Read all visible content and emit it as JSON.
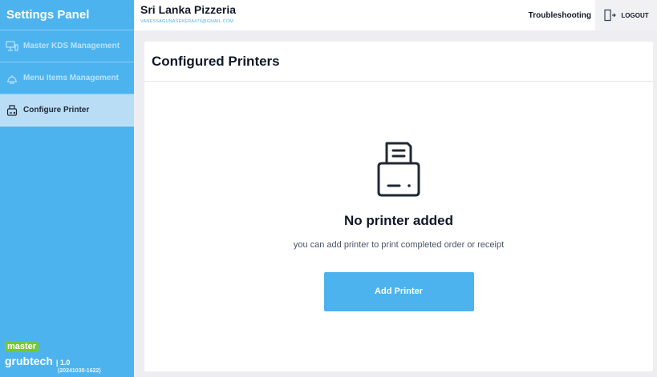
{
  "sidebar": {
    "title": "Settings Panel",
    "items": [
      {
        "label": "Master KDS Management",
        "icon": "kds-icon",
        "active": false
      },
      {
        "label": "Menu Items Management",
        "icon": "menu-items-icon",
        "active": false
      },
      {
        "label": "Configure Printer",
        "icon": "printer-icon",
        "active": true
      }
    ],
    "brand": {
      "badge": "master",
      "name": "grubtech",
      "version": "| 1.0",
      "build": "(20241030-1622)"
    }
  },
  "header": {
    "restaurant": "Sri Lanka Pizzeria",
    "email": "VANESSAGUNASEKERA476@GMAIL.COM",
    "troubleshooting": "Troubleshooting",
    "logout": "LOGOUT"
  },
  "main": {
    "title": "Configured Printers",
    "empty_title": "No printer added",
    "empty_subtitle": "you can add printer to print completed order or receipt",
    "add_button": "Add Printer"
  },
  "colors": {
    "accent": "#4db3ee",
    "active_item": "#b9ddf4",
    "brand_green": "#72c933"
  }
}
